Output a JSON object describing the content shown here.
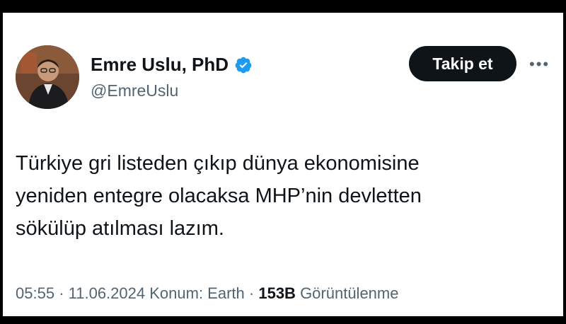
{
  "tweet": {
    "author_name": "Emre Uslu, PhD",
    "handle": "@EmreUslu",
    "follow_label": "Takip et",
    "more_icon": "more-dots-icon",
    "verified_icon": "verified-badge-icon",
    "accent_color": "#1d9bf0",
    "lines": [
      "Türkiye gri listeden çıkıp dünya ekonomisine",
      "yeniden entegre olacaksa MHP’nin devletten",
      "sökülüp atılması lazım."
    ],
    "time": "05:55",
    "date": "11.06.2024",
    "location_text": "Konum: Earth",
    "views_count": "153B",
    "views_label": "Görüntülenme"
  }
}
